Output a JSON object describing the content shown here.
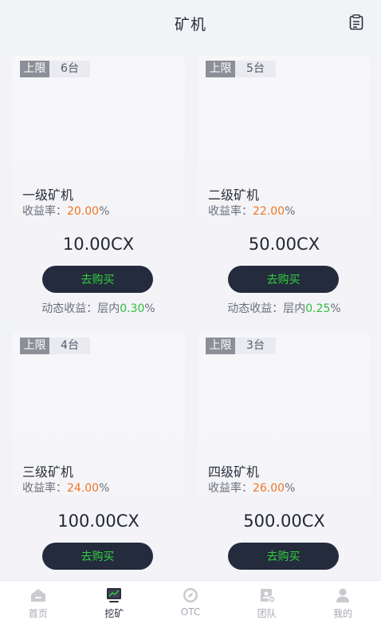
{
  "header": {
    "title": "矿机"
  },
  "cards": [
    {
      "limit_label": "上限",
      "count": "6台",
      "name": "一级矿机",
      "rate_label": "收益率：",
      "rate_value": "20.00",
      "rate_unit": "%",
      "price": "10.00CX",
      "buy_label": "去购买",
      "dynamic_label": "动态收益：层内",
      "dynamic_value": "0.30",
      "dynamic_unit": "%"
    },
    {
      "limit_label": "上限",
      "count": "5台",
      "name": "二级矿机",
      "rate_label": "收益率：",
      "rate_value": "22.00",
      "rate_unit": "%",
      "price": "50.00CX",
      "buy_label": "去购买",
      "dynamic_label": "动态收益：层内",
      "dynamic_value": "0.25",
      "dynamic_unit": "%"
    },
    {
      "limit_label": "上限",
      "count": "4台",
      "name": "三级矿机",
      "rate_label": "收益率：",
      "rate_value": "24.00",
      "rate_unit": "%",
      "price": "100.00CX",
      "buy_label": "去购买"
    },
    {
      "limit_label": "上限",
      "count": "3台",
      "name": "四级矿机",
      "rate_label": "收益率：",
      "rate_value": "26.00",
      "rate_unit": "%",
      "price": "500.00CX",
      "buy_label": "去购买"
    }
  ],
  "tabbar": {
    "items": [
      {
        "label": "首页",
        "icon": "home-icon"
      },
      {
        "label": "挖矿",
        "icon": "monitor-icon",
        "active": true
      },
      {
        "label": "OTC",
        "icon": "compass-icon"
      },
      {
        "label": "团队",
        "icon": "team-icon"
      },
      {
        "label": "我的",
        "icon": "user-icon"
      }
    ]
  },
  "colors": {
    "accent_orange": "#f07522",
    "accent_green": "#2fd13c",
    "button_dark": "#242b3d"
  }
}
